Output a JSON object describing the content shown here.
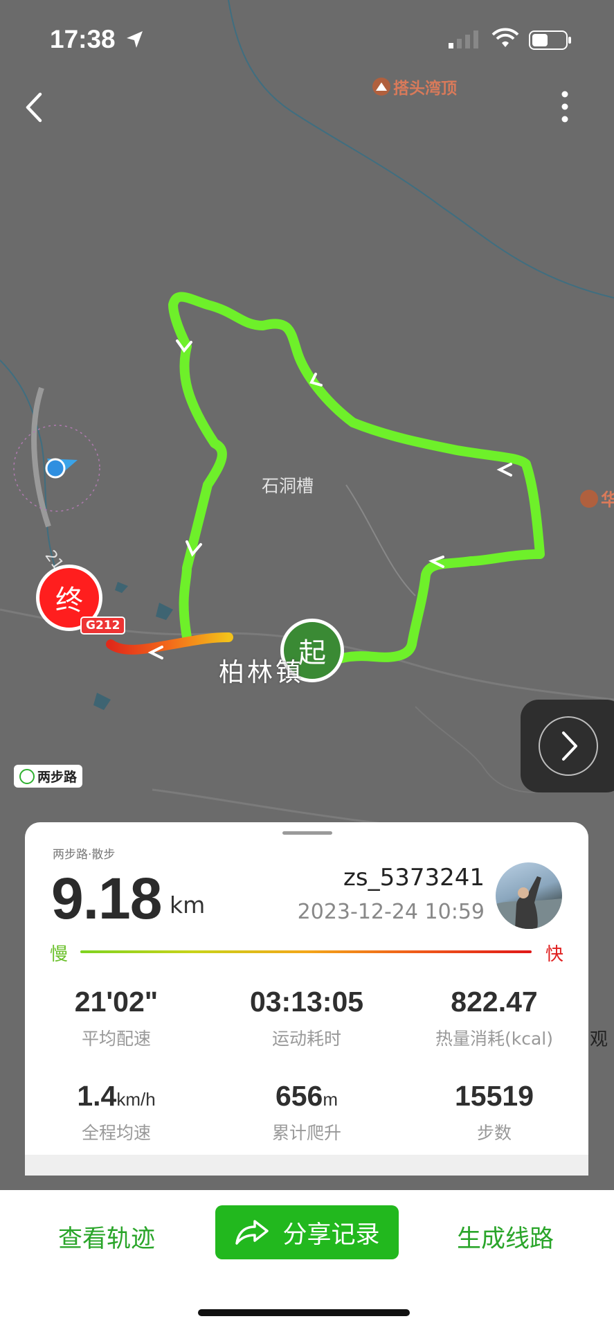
{
  "status_bar": {
    "time": "17:38"
  },
  "map": {
    "poi_peak": "搭头湾顶",
    "poi_area": "石洞槽",
    "town": "柏林镇",
    "road_name": "212国道",
    "road_badge": "G212",
    "start_marker": "起",
    "end_marker": "终",
    "brand": "两步路",
    "edge_poi": "华"
  },
  "card": {
    "sport_type": "两步路·散步",
    "distance": "9.18",
    "distance_unit": "km",
    "username": "zs_5373241",
    "datetime": "2023-12-24 10:59",
    "speed_slow": "慢",
    "speed_fast": "快",
    "stats": [
      {
        "value": "21'02\"",
        "unit": "",
        "label": "平均配速"
      },
      {
        "value": "03:13:05",
        "unit": "",
        "label": "运动耗时"
      },
      {
        "value": "822.47",
        "unit": "",
        "label": "热量消耗(kcal)"
      },
      {
        "value": "1.4",
        "unit": "km/h",
        "label": "全程均速"
      },
      {
        "value": "656",
        "unit": "m",
        "label": "累计爬升"
      },
      {
        "value": "15519",
        "unit": "",
        "label": "步数"
      }
    ],
    "edge_text": "观"
  },
  "bottom_bar": {
    "view_track": "查看轨迹",
    "share": "分享记录",
    "generate_route": "生成线路"
  },
  "colors": {
    "track": "#6ef02a",
    "accent_green": "#22b81e",
    "start_green": "#3a8a34",
    "end_red": "#ff1e1e"
  }
}
